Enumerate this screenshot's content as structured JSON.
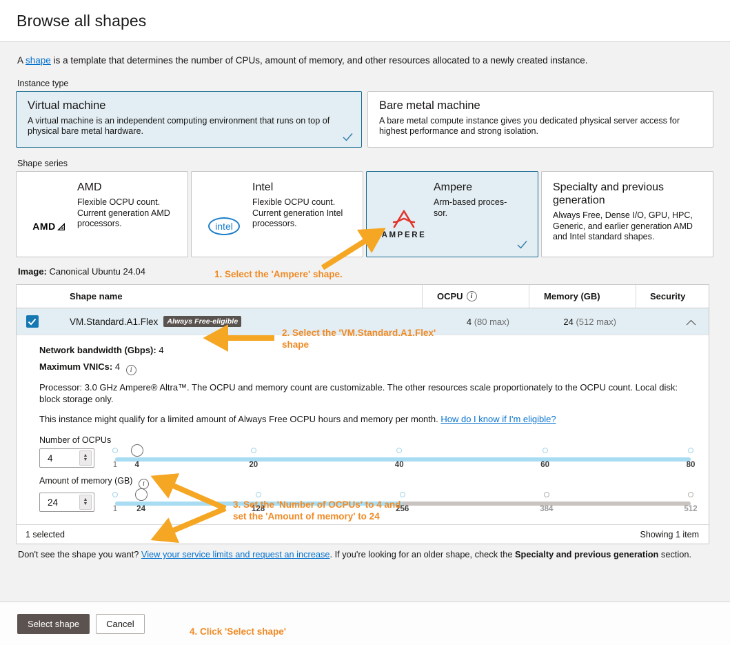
{
  "header": {
    "title": "Browse all shapes"
  },
  "intro": {
    "prefix": "A ",
    "link": "shape",
    "suffix": " is a template that determines the number of CPUs, amount of memory, and other resources allocated to a newly created instance."
  },
  "instance_type": {
    "label": "Instance type",
    "options": [
      {
        "title": "Virtual machine",
        "desc": "A virtual machine is an independent computing environment that runs on top of physical bare metal hardware.",
        "selected": true
      },
      {
        "title": "Bare metal machine",
        "desc": "A bare metal compute instance gives you dedicated physical server access for highest performance and strong isolation.",
        "selected": false
      }
    ]
  },
  "shape_series": {
    "label": "Shape series",
    "options": [
      {
        "name": "AMD",
        "desc": "Flexible OCPU count. Current generation AMD processors.",
        "logo": "amd-logo",
        "selected": false
      },
      {
        "name": "Intel",
        "desc": "Flexible OCPU count. Current generation Intel processors.",
        "logo": "intel-logo",
        "logo_text": "intel",
        "selected": false
      },
      {
        "name": "Ampere",
        "desc": "Arm-based proces-\nsor.",
        "logo": "ampere-logo",
        "logo_text": "AMPERE",
        "selected": true
      },
      {
        "name": "Specialty and previous generation",
        "desc": "Always Free, Dense I/O, GPU, HPC, Generic, and earlier generation AMD and Intel standard shapes.",
        "logo": "none",
        "selected": false
      }
    ]
  },
  "image": {
    "label": "Image:",
    "value": "Canonical Ubuntu 24.04"
  },
  "table": {
    "columns": [
      "Shape name",
      "OCPU",
      "Memory (GB)",
      "Security"
    ],
    "row": {
      "checked": true,
      "name": "VM.Standard.A1.Flex",
      "badge": "Always Free-eligible",
      "ocpu_value": "4",
      "ocpu_max": "(80 max)",
      "memory_value": "24",
      "memory_max": "(512 max)",
      "security": ""
    },
    "footer_left": "1 selected",
    "footer_right": "Showing 1 item"
  },
  "detail": {
    "network_label": "Network bandwidth (Gbps):",
    "network_value": "4",
    "vnics_label": "Maximum VNICs:",
    "vnics_value": "4",
    "processor": "Processor: 3.0 GHz Ampere® Altra™. The OCPU and memory count are customizable. The other resources scale proportionately to the OCPU count. Local disk: block storage only.",
    "free_text": "This instance might qualify for a limited amount of Always Free OCPU hours and memory per month. ",
    "free_link": "How do I know if I'm eligible?"
  },
  "ocpu_slider": {
    "label": "Number of OCPUs",
    "value": "4",
    "min": 1,
    "max": 80,
    "fill_to": 80,
    "ticks": [
      {
        "label": "1",
        "pos": 1,
        "dim": true
      },
      {
        "label": "4",
        "pos": 4,
        "dim": false,
        "nodot": true
      },
      {
        "label": "20",
        "pos": 20,
        "dim": false
      },
      {
        "label": "40",
        "pos": 40,
        "dim": false
      },
      {
        "label": "60",
        "pos": 60,
        "dim": false
      },
      {
        "label": "80",
        "pos": 80,
        "dim": false
      }
    ]
  },
  "memory_slider": {
    "label": "Amount of memory (GB)",
    "value": "24",
    "min": 1,
    "max": 512,
    "fill_to": 256,
    "ticks": [
      {
        "label": "1",
        "pos": 1,
        "dim": true
      },
      {
        "label": "24",
        "pos": 24,
        "dim": false,
        "nodot": true
      },
      {
        "label": "128",
        "pos": 128,
        "dim": false
      },
      {
        "label": "256",
        "pos": 256,
        "dim": false
      },
      {
        "label": "384",
        "pos": 384,
        "dim": true
      },
      {
        "label": "512",
        "pos": 512,
        "dim": true
      }
    ]
  },
  "below_table": {
    "p1": "Don't see the shape you want? ",
    "link": "View your service limits and request an increase",
    "p2": ". If you're looking for an older shape, check the ",
    "bold": "Specialty and previous generation",
    "p3": " section."
  },
  "footer": {
    "primary": "Select shape",
    "secondary": "Cancel"
  },
  "annotations": {
    "step1": "1. Select the 'Ampere' shape.",
    "step2": "2. Select the 'VM.Standard.A1.Flex'\nshape",
    "step3": "3. Set the 'Number of OCPUs' to 4 and\nset the 'Amount of memory' to 24",
    "step4": "4. Click 'Select shape'",
    "color": "#f08a24"
  }
}
